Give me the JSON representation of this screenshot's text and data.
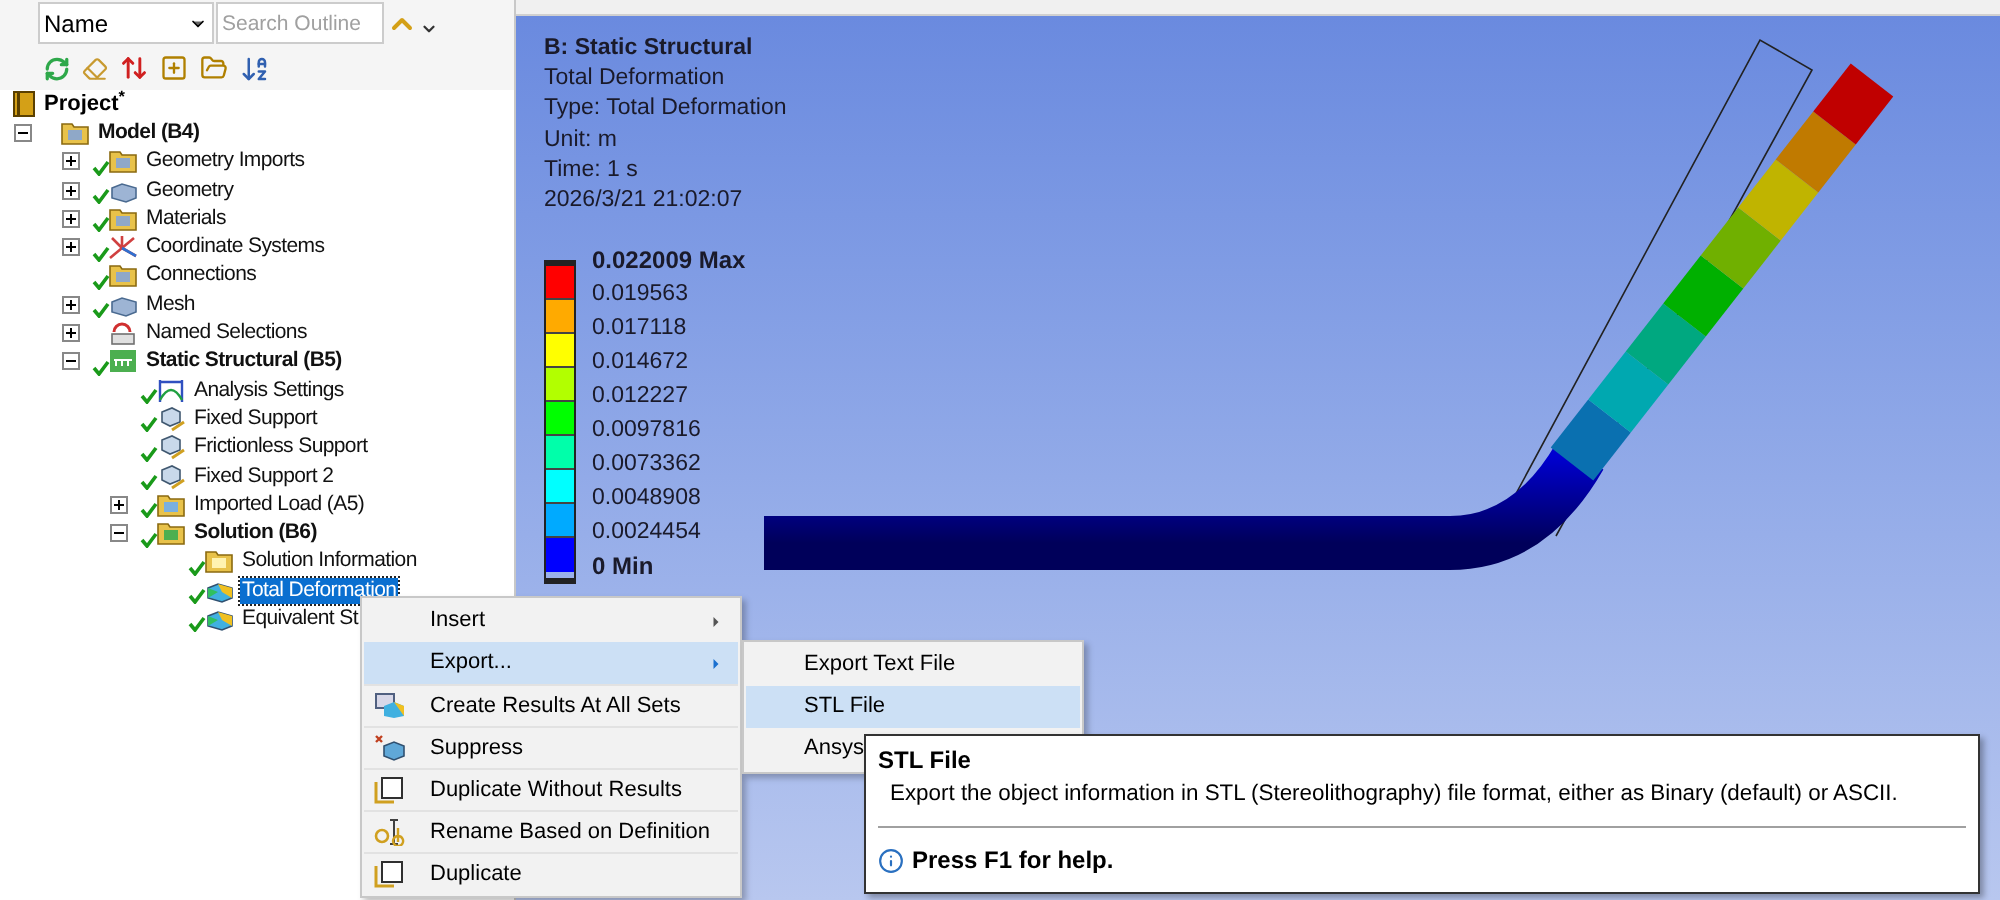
{
  "outline_toolbar": {
    "filter": "Name",
    "search": {
      "placeholder": "Search Outline"
    }
  },
  "project": {
    "label": "Project$^{*}$"
  },
  "tree": [
    {
      "label": "Model (B4)",
      "kind": "model",
      "bold": true,
      "has_toggle": true,
      "expanded": true,
      "checked": false,
      "selected": false,
      "children": [
        {
          "label": "Geometry Imports",
          "kind": "folder",
          "bold": false,
          "has_toggle": true,
          "expanded": false,
          "checked": true,
          "selected": false
        },
        {
          "label": "Geometry",
          "kind": "part",
          "bold": false,
          "has_toggle": true,
          "expanded": false,
          "checked": true,
          "selected": false
        },
        {
          "label": "Materials",
          "kind": "folder",
          "bold": false,
          "has_toggle": true,
          "expanded": false,
          "checked": true,
          "selected": false
        },
        {
          "label": "Coordinate Systems",
          "kind": "axes",
          "bold": false,
          "has_toggle": true,
          "expanded": false,
          "checked": true,
          "selected": false
        },
        {
          "label": "Connections",
          "kind": "folder",
          "bold": false,
          "has_toggle": false,
          "checked": true,
          "selected": false
        },
        {
          "label": "Mesh",
          "kind": "part",
          "bold": false,
          "has_toggle": true,
          "expanded": false,
          "checked": true,
          "selected": false
        },
        {
          "label": "Named Selections",
          "kind": "selection",
          "bold": false,
          "has_toggle": true,
          "expanded": false,
          "checked": false,
          "selected": false
        },
        {
          "label": "Static Structural (B5)",
          "kind": "analysis",
          "bold": true,
          "has_toggle": true,
          "expanded": true,
          "checked": true,
          "selected": false,
          "children": [
            {
              "label": "Analysis Settings",
              "kind": "settings",
              "bold": false,
              "has_toggle": false,
              "checked": true,
              "selected": false
            },
            {
              "label": "Fixed Support",
              "kind": "support",
              "bold": false,
              "has_toggle": false,
              "checked": true,
              "selected": false
            },
            {
              "label": "Frictionless Support",
              "kind": "support",
              "bold": false,
              "has_toggle": false,
              "checked": true,
              "selected": false
            },
            {
              "label": "Fixed Support 2",
              "kind": "support",
              "bold": false,
              "has_toggle": false,
              "checked": true,
              "selected": false
            },
            {
              "label": "Imported Load (A5)",
              "kind": "load",
              "bold": false,
              "has_toggle": true,
              "expanded": false,
              "checked": true,
              "selected": false
            },
            {
              "label": "Solution (B6)",
              "kind": "solution",
              "bold": true,
              "has_toggle": true,
              "expanded": true,
              "checked": true,
              "selected": false,
              "children": [
                {
                  "label": "Solution Information",
                  "kind": "info",
                  "bold": false,
                  "has_toggle": false,
                  "checked": true,
                  "selected": false
                },
                {
                  "label": "Total Deformation",
                  "kind": "result",
                  "bold": false,
                  "has_toggle": false,
                  "checked": true,
                  "selected": true
                },
                {
                  "label": "Equivalent St",
                  "kind": "result",
                  "bold": false,
                  "has_toggle": false,
                  "checked": true,
                  "selected": false
                }
              ]
            }
          ]
        }
      ]
    }
  ],
  "viewport": {
    "title": "B: Static Structural",
    "info": [
      "Total Deformation",
      "Type: Total Deformation",
      "Unit: m",
      "Time: 1 s",
      "2026/3/21 21:02:07"
    ],
    "legend": {
      "labels": [
        "0.022009 Max",
        "0.019563",
        "0.017118",
        "0.014672",
        "0.012227",
        "0.0097816",
        "0.0073362",
        "0.0048908",
        "0.0024454",
        "0 Min"
      ],
      "bands": [
        {
          "color": "#ff0000"
        },
        {
          "color": "#ffaa00"
        },
        {
          "color": "#ffff00"
        },
        {
          "color": "#b2ff00"
        },
        {
          "color": "#00ff00"
        },
        {
          "color": "#00ffaa"
        },
        {
          "color": "#00ffff"
        },
        {
          "color": "#00aaff"
        },
        {
          "color": "#0000ff"
        }
      ]
    }
  },
  "context_menu": [
    {
      "label": "Insert",
      "kind": "none",
      "submenu": true,
      "selected": false
    },
    {
      "label": "Export...",
      "kind": "none",
      "submenu": true,
      "selected": true
    },
    {
      "label": "Create Results At All Sets",
      "kind": "results",
      "submenu": false,
      "selected": false
    },
    {
      "label": "Suppress",
      "kind": "suppress",
      "submenu": false,
      "selected": false
    },
    {
      "label": "Duplicate Without Results",
      "kind": "duplicate",
      "submenu": false,
      "selected": false
    },
    {
      "label": "Rename Based on Definition",
      "kind": "rename",
      "submenu": false,
      "selected": false
    },
    {
      "label": "Duplicate",
      "kind": "duplicate",
      "submenu": false,
      "selected": false
    }
  ],
  "submenu": [
    {
      "label": "Export Text File",
      "selected": false
    },
    {
      "label": "STL File",
      "selected": true
    },
    {
      "label": "Ansys",
      "selected": false
    }
  ],
  "tooltip": {
    "title": "STL File",
    "text": "Export the object information in STL (Stereolithography) file format, either as Binary (default) or ASCII.",
    "help": "Press F1 for help."
  }
}
